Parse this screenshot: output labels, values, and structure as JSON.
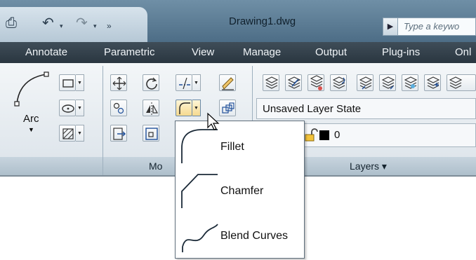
{
  "window": {
    "title": "Drawing1.dwg"
  },
  "search": {
    "placeholder": "Type a keywo"
  },
  "tabs": [
    "Annotate",
    "Parametric",
    "View",
    "Manage",
    "Output",
    "Plug-ins",
    "Onl"
  ],
  "ribbon": {
    "arc_label": "Arc",
    "modify_panel_label": "Mo",
    "layers_panel_label": "Layers ▾",
    "layer_state": "Unsaved Layer State",
    "current_layer": "0",
    "current_layer_color": "#000000"
  },
  "menu": {
    "items": [
      {
        "label": "Fillet",
        "icon": "fillet-icon"
      },
      {
        "label": "Chamfer",
        "icon": "chamfer-icon"
      },
      {
        "label": "Blend Curves",
        "icon": "blend-curves-icon"
      }
    ]
  },
  "colors": {
    "title_bar": "#5a7a92",
    "tab_bar": "#34414b",
    "ribbon": "#e9eef2",
    "panel_bar": "#b9c8d3"
  }
}
